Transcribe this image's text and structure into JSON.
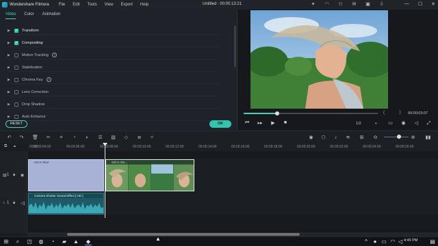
{
  "titlebar": {
    "app_name": "Wondershare Filmora",
    "menu": [
      "File",
      "Edit",
      "Tools",
      "View",
      "Export",
      "Help"
    ],
    "document_title": "Untitled : 00:00:13:21",
    "window_controls": [
      "—",
      "☐",
      "✕"
    ]
  },
  "panel": {
    "tabs": [
      "Video",
      "Color",
      "Animation"
    ],
    "active_tab": "Video",
    "properties": [
      {
        "label": "Transform",
        "checked": true,
        "info": false
      },
      {
        "label": "Compositing",
        "checked": true,
        "info": false
      },
      {
        "label": "Motion Tracking",
        "checked": false,
        "info": true
      },
      {
        "label": "Stabilization",
        "checked": false,
        "info": false
      },
      {
        "label": "Chroma Key",
        "checked": false,
        "info": true
      },
      {
        "label": "Lens Correction",
        "checked": false,
        "info": false
      },
      {
        "label": "Drop Shadow",
        "checked": false,
        "info": false
      },
      {
        "label": "Auto Enhance",
        "checked": false,
        "info": false
      }
    ],
    "reset_label": "RESET",
    "ok_label": "OK"
  },
  "preview": {
    "timecode": "00:00:03:07",
    "progress": 0.25,
    "page": "1/2",
    "accent_color": "#3fd3c1"
  },
  "timeline": {
    "ruler_ticks": [
      "00:00",
      "00:00:04:00",
      "00:00:06:00",
      "00:00:08:00",
      "00:00:10:00",
      "00:00:12:00",
      "00:00:14:00",
      "00:00:16:00",
      "00:00:18:00",
      "00:00:20:00",
      "00:00:22:00",
      "00:00:24:00",
      "00:00:26:00"
    ],
    "clip1_label": "Moon Blue",
    "clip2_label": "Girl is Sm...",
    "audio_label": "Camera Shutter Sound Effect [ HD ]",
    "track_labels": [
      "1",
      "1"
    ]
  },
  "taskbar": {
    "time": "4:45 PM"
  }
}
